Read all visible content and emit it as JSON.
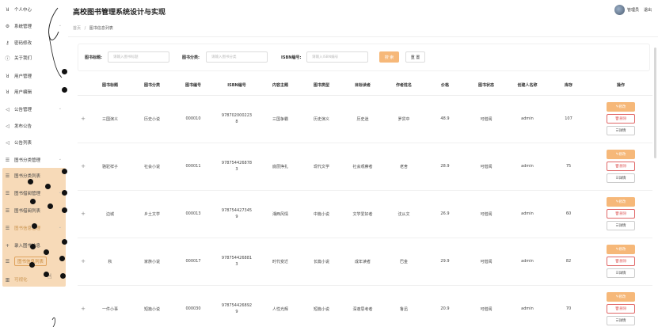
{
  "header": {
    "title": "高校图书管理系统设计与实现",
    "user": "管理员",
    "logout": "退出"
  },
  "breadcrumb": {
    "home": "首页",
    "sep": "/",
    "current": "图书信息列表"
  },
  "sidebar": {
    "items": [
      {
        "icon": "user-icon",
        "glyph": "ꓤ",
        "label": "个人中心"
      },
      {
        "icon": "gear-icon",
        "glyph": "⚙",
        "label": "系统管理"
      },
      {
        "icon": "key-icon",
        "glyph": "⚷",
        "label": "密码修改"
      },
      {
        "icon": "info-icon",
        "glyph": "ⓘ",
        "label": "关于我们"
      },
      {
        "icon": "users-icon",
        "glyph": "ꓤ",
        "label": "用户管理"
      },
      {
        "icon": "user-edit-icon",
        "glyph": "ꓤ",
        "label": "用户编辑"
      },
      {
        "icon": "megaphone-icon",
        "glyph": "◁",
        "label": "公告管理"
      },
      {
        "icon": "megaphone-icon",
        "glyph": "◁",
        "label": "发布公告"
      },
      {
        "icon": "megaphone-icon",
        "glyph": "◁",
        "label": "公告列表"
      },
      {
        "icon": "list-icon",
        "glyph": "☰",
        "label": "图书分类管理"
      },
      {
        "icon": "list-icon",
        "glyph": "☰",
        "label": "图书分类列表"
      },
      {
        "icon": "list-icon",
        "glyph": "☰",
        "label": "图书借阅管理"
      },
      {
        "icon": "list-icon",
        "glyph": "☰",
        "label": "图书借阅列表"
      },
      {
        "icon": "list-icon",
        "glyph": "☰",
        "label": "图书信息管理"
      },
      {
        "icon": "plus-icon",
        "glyph": "+",
        "label": "录入图书信息"
      },
      {
        "icon": "list-icon",
        "glyph": "☰",
        "label": "图书信息列表"
      },
      {
        "icon": "chart-icon",
        "glyph": "▥",
        "label": "可视化"
      }
    ]
  },
  "search": {
    "title_label": "图书标题:",
    "title_placeholder": "请输入图书标题",
    "category_label": "图书分类:",
    "category_placeholder": "请输入图书分类",
    "isbn_label": "ISBN编号:",
    "isbn_placeholder": "请输入ISBN编号",
    "search_button": "搜 索",
    "reset_button": "重 置"
  },
  "table": {
    "columns": [
      "图书标题",
      "图书分类",
      "图书编号",
      "ISBN编号",
      "内容主题",
      "图书类型",
      "目标读者",
      "作者姓名",
      "价格",
      "图书状态",
      "创建人名称",
      "库存",
      "操作"
    ],
    "actions": {
      "edit": "修改",
      "delete": "删除",
      "detail": "详情"
    },
    "rows": [
      {
        "expand": "+",
        "title": "三国演义",
        "category": "历史小说",
        "code": "000010",
        "isbn": "9787020002238",
        "theme": "三国争霸",
        "type": "历史演义",
        "reader": "历史迷",
        "author": "罗贯中",
        "price": "48.9",
        "status": "可借阅",
        "creator": "admin",
        "stock": "107"
      },
      {
        "expand": "+",
        "title": "骆驼祥子",
        "category": "社会小说",
        "code": "000011",
        "isbn": "9787544268783",
        "theme": "底层挣扎",
        "type": "现代文学",
        "reader": "社会观察者",
        "author": "老舍",
        "price": "28.9",
        "status": "可借阅",
        "creator": "admin",
        "stock": "75"
      },
      {
        "expand": "+",
        "title": "边城",
        "category": "乡土文学",
        "code": "000013",
        "isbn": "9787544273459",
        "theme": "湘西风情",
        "type": "中篇小说",
        "reader": "文学爱好者",
        "author": "沈从文",
        "price": "26.9",
        "status": "可借阅",
        "creator": "admin",
        "stock": "60"
      },
      {
        "expand": "+",
        "title": "秋",
        "category": "家族小说",
        "code": "000017",
        "isbn": "9787544268813",
        "theme": "时代变迁",
        "type": "长篇小说",
        "reader": "成年读者",
        "author": "巴金",
        "price": "29.9",
        "status": "可借阅",
        "creator": "admin",
        "stock": "82"
      },
      {
        "expand": "+",
        "title": "一件小事",
        "category": "短篇小说",
        "code": "000030",
        "isbn": "9787544268929",
        "theme": "人性光辉",
        "type": "短篇小说",
        "reader": "深邃思考者",
        "author": "鲁迅",
        "price": "20.9",
        "status": "可借阅",
        "creator": "admin",
        "stock": "70"
      }
    ]
  },
  "colors": {
    "accent": "#f6b879",
    "danger": "#e06767",
    "panel": "#f6d3ab"
  }
}
